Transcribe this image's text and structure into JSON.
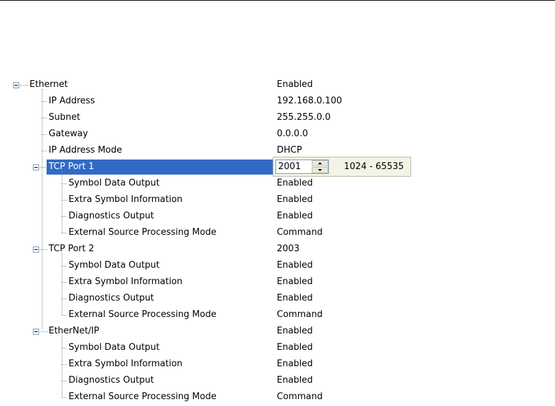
{
  "tree": [
    {
      "label": "Ethernet",
      "value": "Enabled",
      "level": 0,
      "expander": true
    },
    {
      "label": "IP Address",
      "value": "192.168.0.100",
      "level": 1
    },
    {
      "label": "Subnet",
      "value": "255.255.0.0",
      "level": 1
    },
    {
      "label": "Gateway",
      "value": "0.0.0.0",
      "level": 1
    },
    {
      "label": "IP Address Mode",
      "value": "DHCP",
      "level": 1
    },
    {
      "label": "TCP Port 1",
      "value": "",
      "level": 1,
      "expander": true,
      "selected": true
    },
    {
      "label": "Symbol Data Output",
      "value": "Enabled",
      "level": 2
    },
    {
      "label": "Extra Symbol Information",
      "value": "Enabled",
      "level": 2
    },
    {
      "label": "Diagnostics Output",
      "value": "Enabled",
      "level": 2
    },
    {
      "label": "External Source Processing Mode",
      "value": "Command",
      "level": 2
    },
    {
      "label": "TCP Port 2",
      "value": "2003",
      "level": 1,
      "expander": true
    },
    {
      "label": "Symbol Data Output",
      "value": "Enabled",
      "level": 2
    },
    {
      "label": "Extra Symbol Information",
      "value": "Enabled",
      "level": 2
    },
    {
      "label": "Diagnostics Output",
      "value": "Enabled",
      "level": 2
    },
    {
      "label": "External Source Processing Mode",
      "value": "Command",
      "level": 2
    },
    {
      "label": "EtherNet/IP",
      "value": "Enabled",
      "level": 1,
      "expander": true
    },
    {
      "label": "Symbol Data Output",
      "value": "Enabled",
      "level": 2
    },
    {
      "label": "Extra Symbol Information",
      "value": "Enabled",
      "level": 2
    },
    {
      "label": "Diagnostics Output",
      "value": "Enabled",
      "level": 2
    },
    {
      "label": "External Source Processing Mode",
      "value": "Command",
      "level": 2
    }
  ],
  "editor": {
    "value": "2001",
    "range": "1024 - 65535",
    "up_icon": "spin-up-icon",
    "down_icon": "spin-down-icon"
  },
  "colors": {
    "selection": "#316ac5",
    "editor_bg": "#f4f4e6"
  }
}
